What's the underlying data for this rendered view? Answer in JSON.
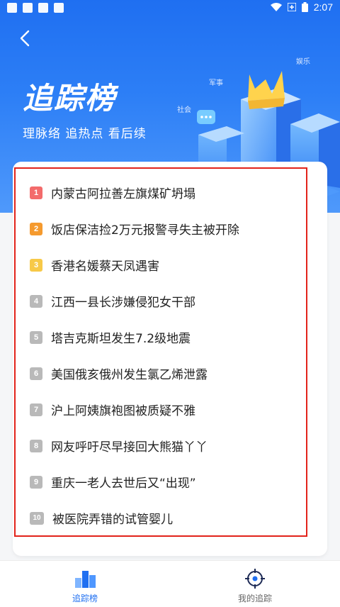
{
  "status_bar": {
    "time": "2:07"
  },
  "header": {
    "title": "追踪榜",
    "subtitle": "理脉络 追热点 看后续",
    "tags": [
      "娱乐",
      "军事",
      "社会"
    ]
  },
  "list": {
    "items": [
      {
        "rank": "1",
        "text": "内蒙古阿拉善左旗煤矿坍塌",
        "color": "#f36b6b"
      },
      {
        "rank": "2",
        "text": "饭店保洁捡2万元报警寻失主被开除",
        "color": "#f59a2e"
      },
      {
        "rank": "3",
        "text": "香港名媛蔡天凤遇害",
        "color": "#f7c948"
      },
      {
        "rank": "4",
        "text": "江西一县长涉嫌侵犯女干部",
        "color": "#b9b9b9"
      },
      {
        "rank": "5",
        "text": "塔吉克斯坦发生7.2级地震",
        "color": "#b9b9b9"
      },
      {
        "rank": "6",
        "text": "美国俄亥俄州发生氯乙烯泄露",
        "color": "#b9b9b9"
      },
      {
        "rank": "7",
        "text": "沪上阿姨旗袍图被质疑不雅",
        "color": "#b9b9b9"
      },
      {
        "rank": "8",
        "text": "网友呼吁尽早接回大熊猫丫丫",
        "color": "#b9b9b9"
      },
      {
        "rank": "9",
        "text": "重庆一老人去世后又“出现”",
        "color": "#b9b9b9"
      },
      {
        "rank": "10",
        "text": "被医院弄错的试管婴儿",
        "color": "#b9b9b9"
      }
    ]
  },
  "tabbar": {
    "tabs": [
      {
        "label": "追踪榜",
        "active": true,
        "color": "#1f6ff1"
      },
      {
        "label": "我的追踪",
        "active": false,
        "color": "#666666"
      }
    ]
  }
}
